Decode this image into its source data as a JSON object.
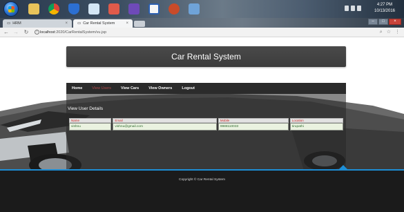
{
  "taskbar": {
    "clock_time": "4:27 PM",
    "clock_date": "10/13/2016"
  },
  "browser": {
    "tabs": [
      {
        "label": "HRM"
      },
      {
        "label": "Car Rental System"
      }
    ],
    "url_host": "localhost",
    "url_path": ":2020/CarRentalSystem/vu.jsp"
  },
  "page": {
    "header_title": "Car Rental System",
    "nav": [
      {
        "label": "Home"
      },
      {
        "label": "View Users",
        "active": true
      },
      {
        "label": "View Cars"
      },
      {
        "label": "View Owners"
      },
      {
        "label": "Logout"
      }
    ],
    "section_title": "View User Details",
    "table": {
      "headers": [
        "Name",
        "Email",
        "Mobile",
        "Location"
      ],
      "rows": [
        [
          "vishnu",
          "vishnu@gmail.com",
          "9988110033",
          "tirupathi"
        ]
      ]
    },
    "footer_text": "Copyright © Car Rental System"
  },
  "colors": {
    "header_bg": "#444444",
    "nav_active": "#b24a4a",
    "table_header_text": "#cc2a2a",
    "table_cell_text": "#2f6b2f",
    "accent_line": "#1d8ed6",
    "footer_bg": "#1b1b1b"
  }
}
